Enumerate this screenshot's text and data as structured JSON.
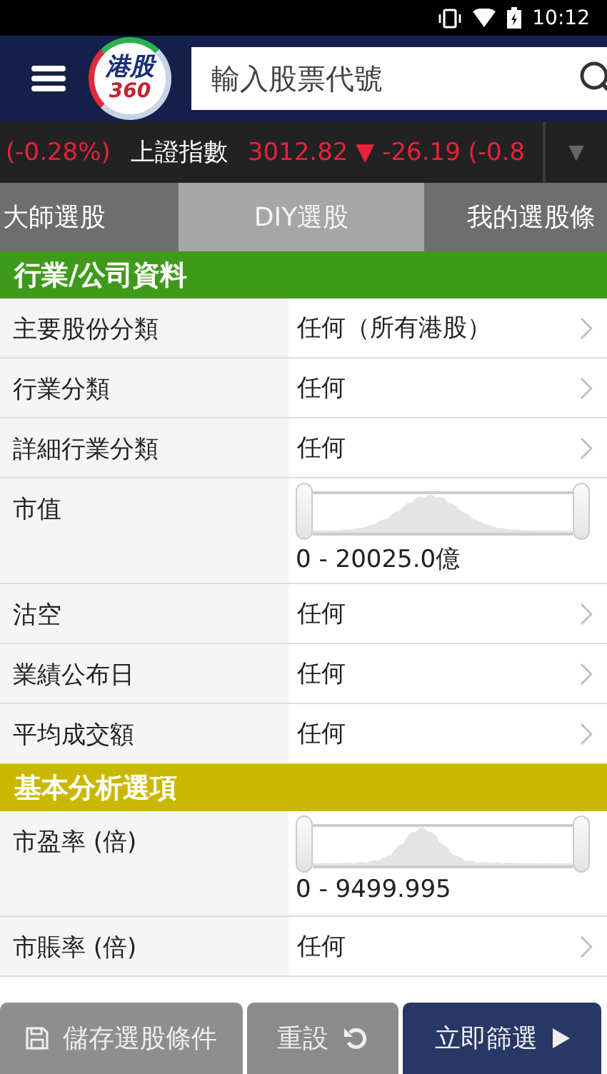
{
  "status_bar": {
    "time": "10:12"
  },
  "header": {
    "logo": {
      "line_1": "港股",
      "line_2": "360"
    },
    "search": {
      "placeholder": "輸入股票代號"
    }
  },
  "ticker": {
    "items": [
      {
        "text": "(-0.28%)",
        "color": "#e8213d"
      },
      {
        "text": "上證指數",
        "color": "#ffffff"
      },
      {
        "text": "3012.82 ▼ -26.19 (-0.8",
        "color": "#e8213d"
      }
    ],
    "dropdown": "▼"
  },
  "tabs": [
    {
      "label": "大師選股",
      "selected": false
    },
    {
      "label": "DIY選股",
      "selected": true
    },
    {
      "label": "我的選股條",
      "selected": false
    }
  ],
  "sections": [
    {
      "title": "行業/公司資料",
      "color": "#3f9a1c",
      "rows": [
        {
          "kind": "choice",
          "label": "主要股份分類",
          "value": "任何（所有港股）"
        },
        {
          "kind": "choice",
          "label": "行業分類",
          "value": "任何"
        },
        {
          "kind": "choice",
          "label": "詳細行業分類",
          "value": "任何"
        },
        {
          "kind": "range",
          "label": "市值",
          "value": "0 - 20025.0億"
        },
        {
          "kind": "choice",
          "label": "沽空",
          "value": "任何"
        },
        {
          "kind": "choice",
          "label": "業績公布日",
          "value": "任何"
        },
        {
          "kind": "choice",
          "label": "平均成交額",
          "value": "任何"
        }
      ]
    },
    {
      "title": "基本分析選項",
      "color": "#c9b800",
      "rows": [
        {
          "kind": "range",
          "label": "市盈率 (倍)",
          "value": "0 - 9499.995"
        },
        {
          "kind": "choice",
          "label": "市賬率 (倍)",
          "value": "任何"
        }
      ]
    }
  ],
  "buttons": [
    {
      "kind": "save",
      "label": "儲存選股條件"
    },
    {
      "kind": "reset",
      "label": "重設"
    },
    {
      "kind": "run",
      "label": "立即篩選"
    }
  ]
}
